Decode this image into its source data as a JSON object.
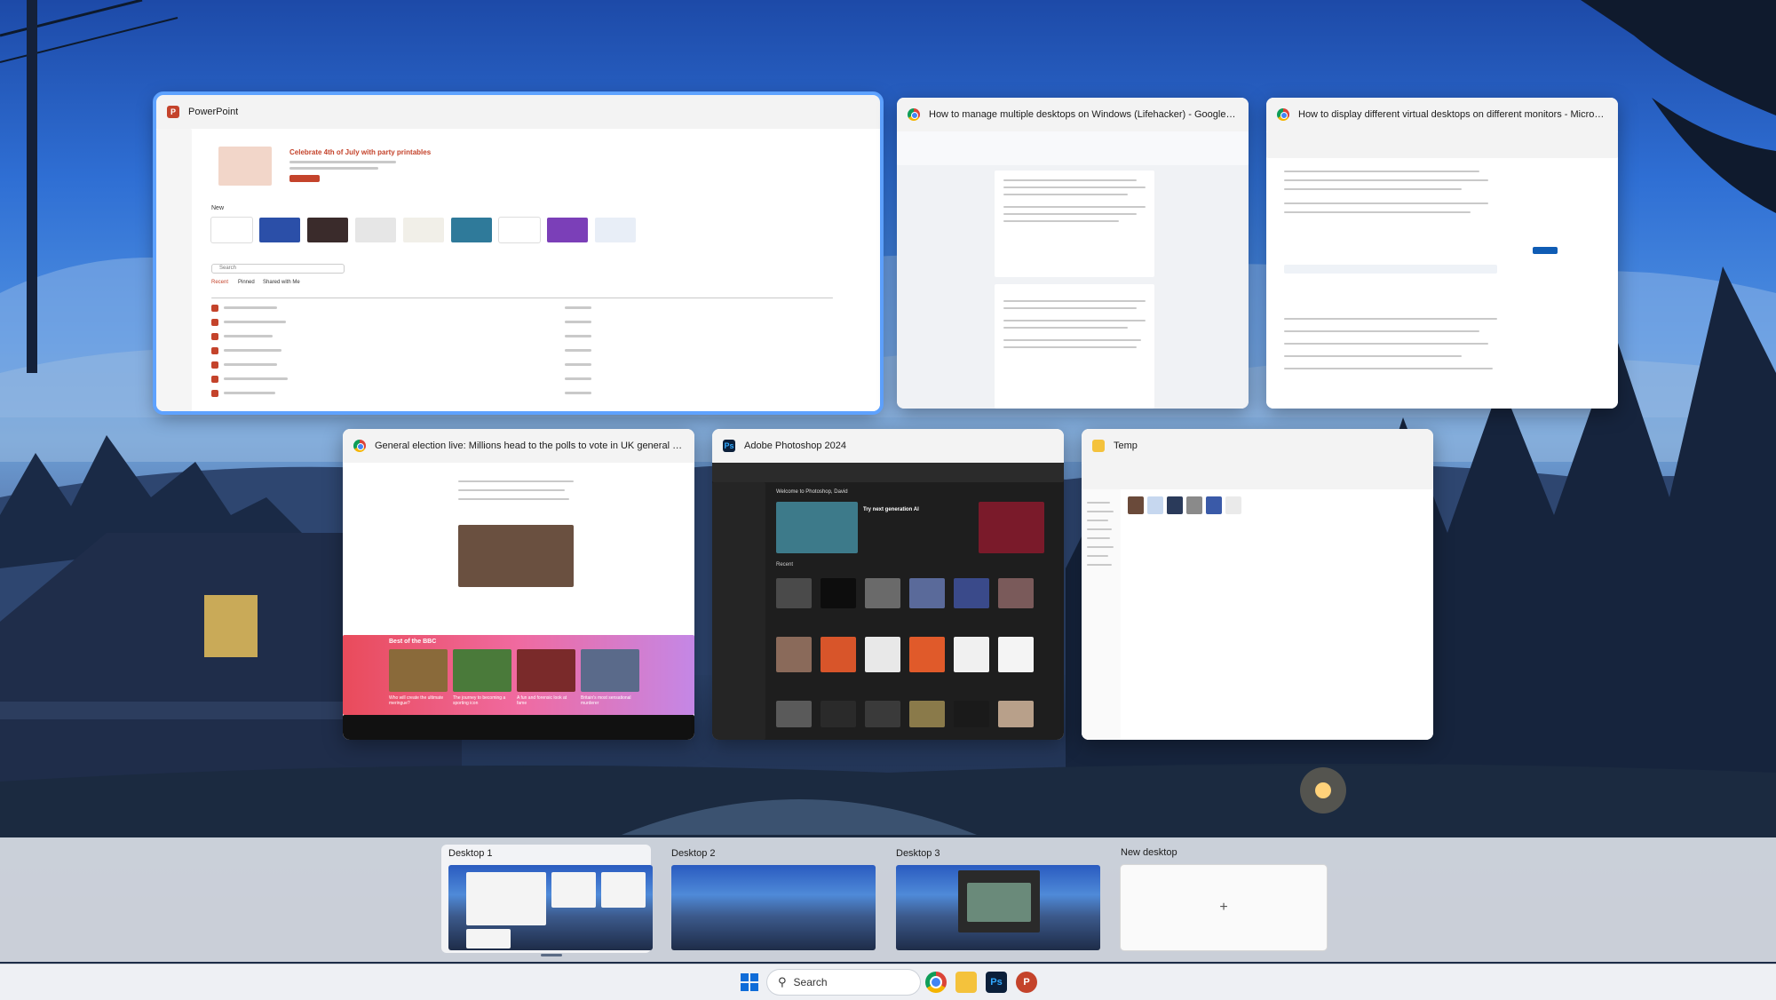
{
  "windows": {
    "powerpoint": {
      "title": "PowerPoint",
      "banner_heading": "Celebrate 4th of July with party printables",
      "new_label": "New",
      "search_placeholder": "Search",
      "tabs": [
        "Recent",
        "Pinned",
        "Shared with Me"
      ]
    },
    "gdocs": {
      "title": "How to manage multiple desktops on Windows (Lifehacker) - Google Docs - Googl..."
    },
    "mscommunity": {
      "title": "How to display different virtual desktops on different monitors - Microsoft Commu..."
    },
    "bbc": {
      "title": "General election live: Millions head to the polls to vote in UK general election - BBC...",
      "section_heading": "Best of the BBC",
      "card_labels": [
        "Who will create the ultimate meringue?",
        "The journey to becoming a sporting icon",
        "A fun and forensic look at fame",
        "Britain's most sensational murderer"
      ]
    },
    "photoshop": {
      "title": "Adobe Photoshop 2024",
      "welcome": "Welcome to Photoshop, David",
      "hero": "Try next generation AI",
      "recent_label": "Recent"
    },
    "temp": {
      "title": "Temp"
    }
  },
  "desktops": [
    {
      "label": "Desktop 1",
      "selected": true
    },
    {
      "label": "Desktop 2",
      "selected": false
    },
    {
      "label": "Desktop 3",
      "selected": false
    }
  ],
  "new_desktop": {
    "label": "New desktop",
    "plus": "+"
  },
  "taskbar": {
    "search_placeholder": "Search",
    "apps": [
      "start-icon",
      "chrome-icon",
      "file-explorer-icon",
      "photoshop-icon",
      "powerpoint-icon"
    ]
  },
  "colors": {
    "accent": "#5ea2ff",
    "powerpoint": "#c4432b",
    "photoshop_bg": "#0b1f3a",
    "photoshop_accent": "#31a8ff"
  }
}
